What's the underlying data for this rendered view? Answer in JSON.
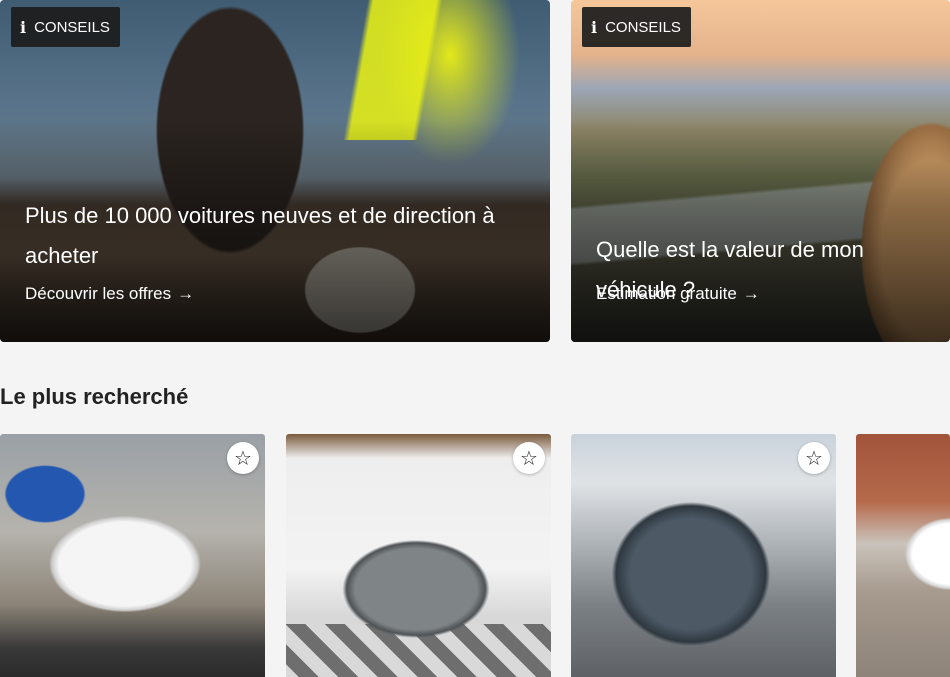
{
  "promos": [
    {
      "tag_icon": "info-icon",
      "tag_label": "CONSEILS",
      "title": "Plus de 10 000 voitures neuves et de direction à acheter",
      "link_label": "Découvrir les offres",
      "link_icon": "arrow-right-icon"
    },
    {
      "tag_icon": "info-icon",
      "tag_label": "CONSEILS",
      "title": "Quelle est la valeur de mon véhicule ?",
      "link_label": "Estimation gratuite",
      "link_icon": "arrow-right-icon"
    }
  ],
  "most_searched": {
    "title": "Le plus recherché",
    "favorite_icon": "star-outline-icon",
    "cards": [
      {
        "image": "white-sports-car-photo"
      },
      {
        "image": "grey-coupe-showroom-photo"
      },
      {
        "image": "grey-suv-photo"
      },
      {
        "image": "white-sedan-photo"
      }
    ]
  }
}
